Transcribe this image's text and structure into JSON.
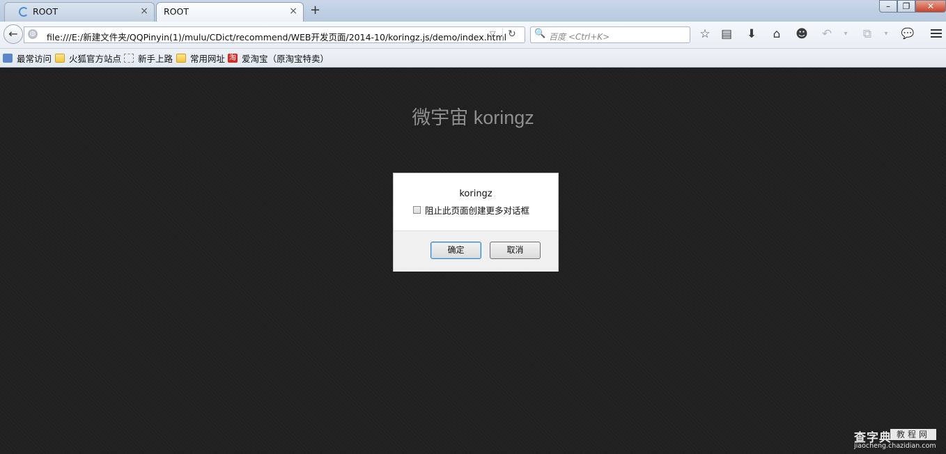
{
  "tabs": [
    {
      "title": "ROOT",
      "loading": true
    },
    {
      "title": "ROOT",
      "active": true
    }
  ],
  "tab_close": "×",
  "new_tab": "+",
  "window_controls": {
    "minimize": "–",
    "restore": "❐",
    "close": "✕"
  },
  "nav": {
    "back": "←",
    "url": "file:///E:/新建文件夹/QQPinyin(1)/mulu/CDict/recommend/WEB开发页面/2014-10/koringz.js/demo/index.html",
    "url_dropdown": "▽",
    "reload": "↻",
    "search_placeholder": "百度 <Ctrl+K>",
    "search_icon": "🔍",
    "toolbar_icons": {
      "bookmark": "☆",
      "reading_list": "▤",
      "downloads": "⬇",
      "home": "⌂",
      "social": "☻",
      "undo": "↶",
      "undo_dropdown": "▾",
      "screenshot": "⧉",
      "screenshot_dropdown": "▾",
      "chat": "💬"
    }
  },
  "bookmarks": [
    {
      "label": "最常访问",
      "icon": "pin-icon"
    },
    {
      "label": "火狐官方站点",
      "icon": "folder-icon"
    },
    {
      "label": "新手上路",
      "icon": "dashed-icon"
    },
    {
      "label": "常用网址",
      "icon": "folder-icon"
    },
    {
      "label": "爱淘宝（原淘宝特卖）",
      "icon": "taobao-icon",
      "icon_text": "淘"
    }
  ],
  "page": {
    "title": "微宇宙 koringz"
  },
  "dialog": {
    "message": "koringz",
    "checkbox_label": "阻止此页面创建更多对话框",
    "ok": "确定",
    "cancel": "取消"
  },
  "watermark": {
    "main": "查字典",
    "box": "教程网",
    "sub": "jiaocheng.chazidian.com"
  },
  "colors": {
    "page_background": "#1f1f20",
    "title_text": "#8f8f8f",
    "ok_border": "#3c7fb1"
  }
}
